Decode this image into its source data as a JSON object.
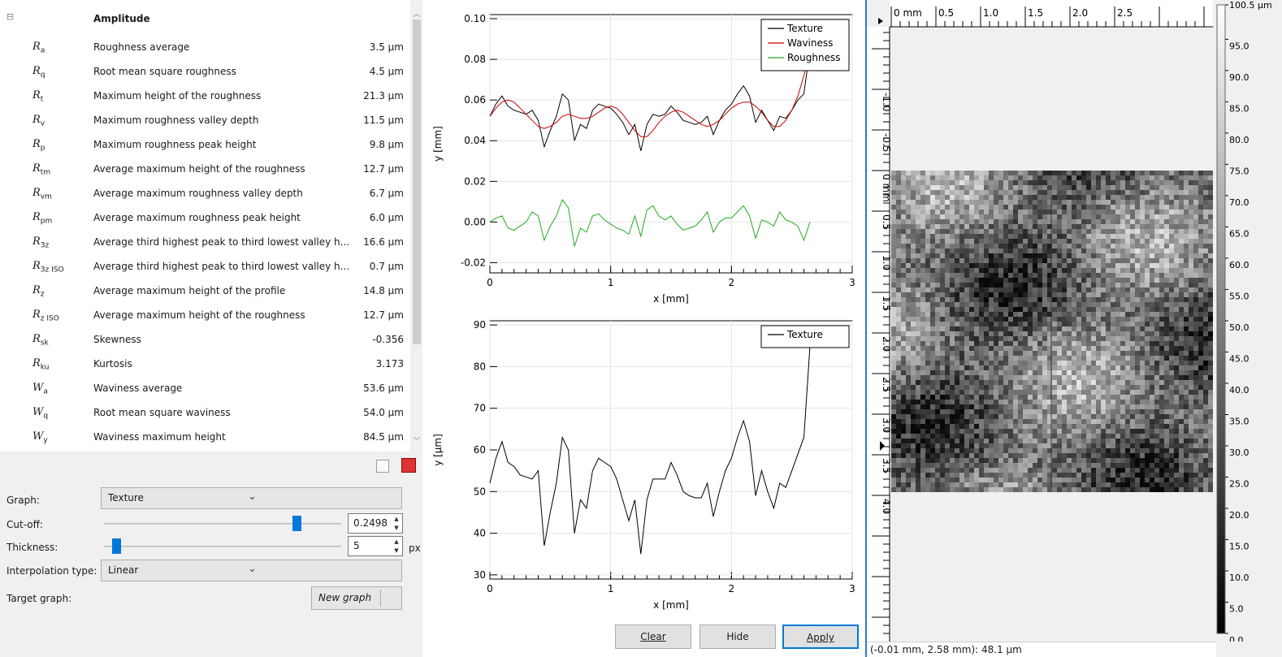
{
  "params": {
    "section_title": "Amplitude",
    "rows": [
      {
        "sym": "R",
        "sub": "a",
        "desc": "Roughness average",
        "val": "3.5 µm"
      },
      {
        "sym": "R",
        "sub": "q",
        "desc": "Root mean square roughness",
        "val": "4.5 µm"
      },
      {
        "sym": "R",
        "sub": "t",
        "desc": "Maximum height of the roughness",
        "val": "21.3 µm"
      },
      {
        "sym": "R",
        "sub": "v",
        "desc": "Maximum roughness valley depth",
        "val": "11.5 µm"
      },
      {
        "sym": "R",
        "sub": "p",
        "desc": "Maximum roughness peak height",
        "val": "9.8 µm"
      },
      {
        "sym": "R",
        "sub": "tm",
        "desc": "Average maximum height of the roughness",
        "val": "12.7 µm"
      },
      {
        "sym": "R",
        "sub": "vm",
        "desc": "Average maximum roughness valley depth",
        "val": "6.7 µm"
      },
      {
        "sym": "R",
        "sub": "pm",
        "desc": "Average maximum roughness peak height",
        "val": "6.0 µm"
      },
      {
        "sym": "R",
        "sub": "3z",
        "desc": "Average third highest peak to third lowest valley h...",
        "val": "16.6 µm"
      },
      {
        "sym": "R",
        "sub": "3z ISO",
        "desc": "Average third highest peak to third lowest valley h...",
        "val": "0.7 µm"
      },
      {
        "sym": "R",
        "sub": "z",
        "desc": "Average maximum height of the profile",
        "val": "14.8 µm"
      },
      {
        "sym": "R",
        "sub": "z ISO",
        "desc": "Average maximum height of the roughness",
        "val": "12.7 µm"
      },
      {
        "sym": "R",
        "sub": "sk",
        "desc": "Skewness",
        "val": "-0.356"
      },
      {
        "sym": "R",
        "sub": "ku",
        "desc": "Kurtosis",
        "val": "3.173"
      },
      {
        "sym": "W",
        "sub": "a",
        "desc": "Waviness average",
        "val": "53.6 µm"
      },
      {
        "sym": "W",
        "sub": "q",
        "desc": "Root mean square waviness",
        "val": "54.0 µm"
      },
      {
        "sym": "W",
        "sub": "y",
        "desc": "Waviness maximum height",
        "val": "84.5 µm"
      }
    ]
  },
  "controls": {
    "graph_label": "Graph:",
    "graph_value": "Texture",
    "cutoff_label": "Cut-off:",
    "cutoff_value": "0.2498",
    "cutoff_level": 0.81,
    "thickness_label": "Thickness:",
    "thickness_value": "5",
    "thickness_unit": "px",
    "thickness_level": 0.05,
    "interp_label": "Interpolation type:",
    "interp_value": "Linear",
    "target_label": "Target graph:",
    "target_value": "New graph"
  },
  "buttons": {
    "clear": "Clear",
    "hide": "Hide",
    "apply": "Apply"
  },
  "chart_data": [
    {
      "type": "line",
      "xlabel": "x [mm]",
      "ylabel": "y [mm]",
      "xlim": [
        0,
        3
      ],
      "ylim": [
        -0.025,
        0.102
      ],
      "xticks": [
        "0",
        "1",
        "2",
        "3"
      ],
      "yticks": [
        "-0.02",
        "0.00",
        "0.02",
        "0.04",
        "0.06",
        "0.08",
        "0.10"
      ],
      "legend_position": "top-right",
      "x": [
        0,
        0.05,
        0.1,
        0.15,
        0.2,
        0.25,
        0.3,
        0.35,
        0.4,
        0.45,
        0.5,
        0.55,
        0.6,
        0.65,
        0.7,
        0.75,
        0.8,
        0.85,
        0.9,
        0.95,
        1.0,
        1.05,
        1.1,
        1.15,
        1.2,
        1.25,
        1.3,
        1.35,
        1.4,
        1.45,
        1.5,
        1.55,
        1.6,
        1.65,
        1.7,
        1.75,
        1.8,
        1.85,
        1.9,
        1.95,
        2.0,
        2.05,
        2.1,
        2.15,
        2.2,
        2.25,
        2.3,
        2.35,
        2.4,
        2.45,
        2.5,
        2.55,
        2.6,
        2.65,
        2.7,
        2.75,
        2.8
      ],
      "series": [
        {
          "name": "Texture",
          "color": "#000000",
          "values": [
            0.052,
            0.058,
            0.062,
            0.057,
            0.055,
            0.054,
            0.053,
            0.055,
            0.05,
            0.037,
            0.045,
            0.052,
            0.063,
            0.06,
            0.04,
            0.048,
            0.046,
            0.055,
            0.058,
            0.057,
            0.056,
            0.053,
            0.049,
            0.043,
            0.048,
            0.035,
            0.048,
            0.053,
            0.052,
            0.053,
            0.057,
            0.054,
            0.05,
            0.049,
            0.048,
            0.049,
            0.052,
            0.043,
            0.05,
            0.055,
            0.058,
            0.063,
            0.067,
            0.062,
            0.049,
            0.055,
            0.05,
            0.045,
            0.052,
            0.051,
            0.055,
            0.06,
            0.063,
            0.085
          ]
        },
        {
          "name": "Waviness",
          "color": "#cc0000",
          "values": [
            0.052,
            0.056,
            0.059,
            0.06,
            0.059,
            0.056,
            0.053,
            0.05,
            0.047,
            0.046,
            0.047,
            0.049,
            0.052,
            0.053,
            0.052,
            0.051,
            0.051,
            0.052,
            0.054,
            0.056,
            0.057,
            0.056,
            0.053,
            0.049,
            0.045,
            0.042,
            0.042,
            0.045,
            0.049,
            0.052,
            0.054,
            0.055,
            0.054,
            0.052,
            0.05,
            0.048,
            0.047,
            0.048,
            0.05,
            0.053,
            0.056,
            0.058,
            0.059,
            0.059,
            0.057,
            0.054,
            0.05,
            0.047,
            0.047,
            0.05,
            0.055,
            0.062,
            0.072,
            0.085
          ]
        },
        {
          "name": "Roughness",
          "color": "#22aa22",
          "values": [
            0.0,
            0.002,
            0.003,
            -0.003,
            -0.004,
            -0.002,
            0.0,
            0.005,
            0.003,
            -0.009,
            -0.002,
            0.003,
            0.011,
            0.007,
            -0.012,
            -0.003,
            -0.005,
            0.003,
            0.004,
            0.001,
            -0.001,
            -0.003,
            -0.004,
            -0.006,
            0.003,
            -0.007,
            0.006,
            0.008,
            0.003,
            0.001,
            0.003,
            -0.001,
            -0.004,
            -0.003,
            -0.002,
            0.001,
            0.005,
            -0.005,
            0.0,
            0.002,
            0.002,
            0.005,
            0.008,
            0.003,
            -0.008,
            0.001,
            0.0,
            -0.002,
            0.005,
            0.001,
            0.0,
            -0.002,
            -0.009,
            0.0
          ]
        }
      ]
    },
    {
      "type": "line",
      "xlabel": "x [mm]",
      "ylabel": "y [µm]",
      "xlim": [
        0,
        3
      ],
      "ylim": [
        29,
        91
      ],
      "xticks": [
        "0",
        "1",
        "2",
        "3"
      ],
      "yticks": [
        "30",
        "40",
        "50",
        "60",
        "70",
        "80",
        "90"
      ],
      "legend_position": "top-right",
      "x": [
        0,
        0.05,
        0.1,
        0.15,
        0.2,
        0.25,
        0.3,
        0.35,
        0.4,
        0.45,
        0.5,
        0.55,
        0.6,
        0.65,
        0.7,
        0.75,
        0.8,
        0.85,
        0.9,
        0.95,
        1.0,
        1.05,
        1.1,
        1.15,
        1.2,
        1.25,
        1.3,
        1.35,
        1.4,
        1.45,
        1.5,
        1.55,
        1.6,
        1.65,
        1.7,
        1.75,
        1.8,
        1.85,
        1.9,
        1.95,
        2.0,
        2.05,
        2.1,
        2.15,
        2.2,
        2.25,
        2.3,
        2.35,
        2.4,
        2.45,
        2.5,
        2.55,
        2.6,
        2.65,
        2.7,
        2.75,
        2.8
      ],
      "series": [
        {
          "name": "Texture",
          "color": "#000000",
          "values": [
            52,
            58,
            62,
            57,
            56,
            54,
            53.5,
            53,
            55,
            37,
            45,
            52,
            63,
            60,
            40,
            48,
            46,
            55,
            58,
            57,
            56,
            53,
            48,
            43,
            48,
            35,
            48,
            53,
            53,
            53,
            57,
            54,
            50,
            49,
            48.5,
            48.5,
            52,
            44,
            50,
            55,
            58,
            63,
            67,
            62,
            49,
            55,
            50,
            46,
            52,
            51,
            55,
            59,
            63,
            85
          ]
        }
      ]
    }
  ],
  "image_panel": {
    "x_axis_labels": [
      "0 mm",
      "0.5",
      "1.0",
      "1.5",
      "2.0",
      "2.5"
    ],
    "y_axis_labels": [
      "-1.0",
      "-0.5",
      "0 mm",
      "0.5",
      "1.0",
      "1.5",
      "2.0",
      "2.5",
      "3.0",
      "3.5",
      "4.0"
    ],
    "scale_labels": [
      "100.5 µm",
      "95.0",
      "90.0",
      "85.0",
      "80.0",
      "75.0",
      "70.0",
      "65.0",
      "60.0",
      "55.0",
      "50.0",
      "45.0",
      "40.0",
      "35.0",
      "30.0",
      "25.0",
      "20.0",
      "15.0",
      "10.0",
      "5.0",
      "0.0"
    ],
    "status": "(-0.01 mm, 2.58 mm): 48.1 µm"
  }
}
